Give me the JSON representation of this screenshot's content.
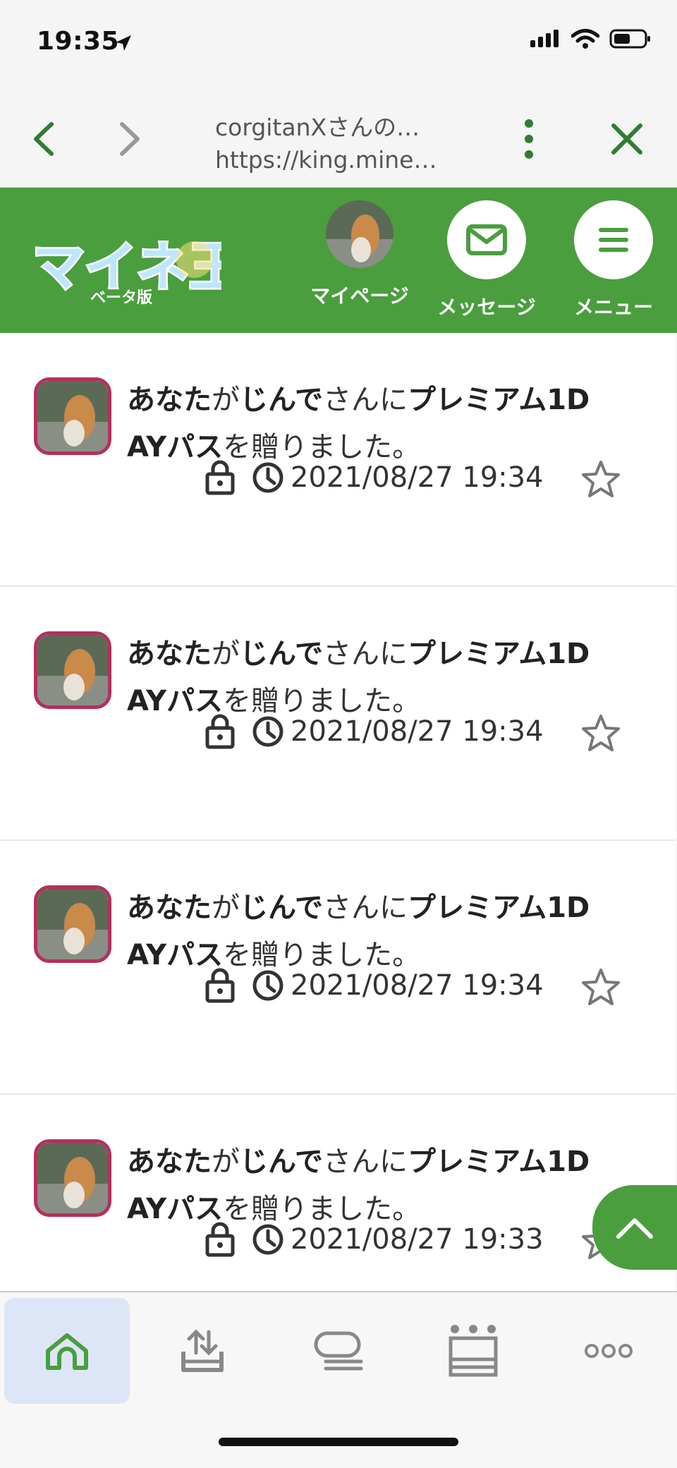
{
  "status_bar": {
    "time": "19:35"
  },
  "browser": {
    "title": "corgitanXさんの…",
    "url": "https://king.mine…"
  },
  "header": {
    "logo_text": "マイネ王",
    "logo_sub": "ベータ版",
    "mypage_label": "マイページ",
    "message_label": "メッセージ",
    "menu_label": "メニュー"
  },
  "feed": {
    "items": [
      {
        "actor": "あなた",
        "p1": "が",
        "target": "じんで",
        "p2": "さんに",
        "item": "プレミアム1D",
        "item2": "AYパス",
        "p3": "を贈りました。",
        "datetime": "2021/08/27 19:34"
      },
      {
        "actor": "あなた",
        "p1": "が",
        "target": "じんで",
        "p2": "さんに",
        "item": "プレミアム1D",
        "item2": "AYパス",
        "p3": "を贈りました。",
        "datetime": "2021/08/27 19:34"
      },
      {
        "actor": "あなた",
        "p1": "が",
        "target": "じんで",
        "p2": "さんに",
        "item": "プレミアム1D",
        "item2": "AYパス",
        "p3": "を贈りました。",
        "datetime": "2021/08/27 19:34"
      },
      {
        "actor": "あなた",
        "p1": "が",
        "target": "じんで",
        "p2": "さんに",
        "item": "プレミアム1D",
        "item2": "AYパス",
        "p3": "を贈りました。",
        "datetime": "2021/08/27 19:33"
      }
    ]
  },
  "colors": {
    "brand_green": "#4a9e3e",
    "avatar_border": "#b3305c",
    "active_tab": "#dde6f7"
  },
  "tabbar": {
    "icons": [
      "home-icon",
      "upload-tray-icon",
      "chat-icon",
      "crown-icon",
      "more-icon"
    ],
    "active_index": 0
  }
}
